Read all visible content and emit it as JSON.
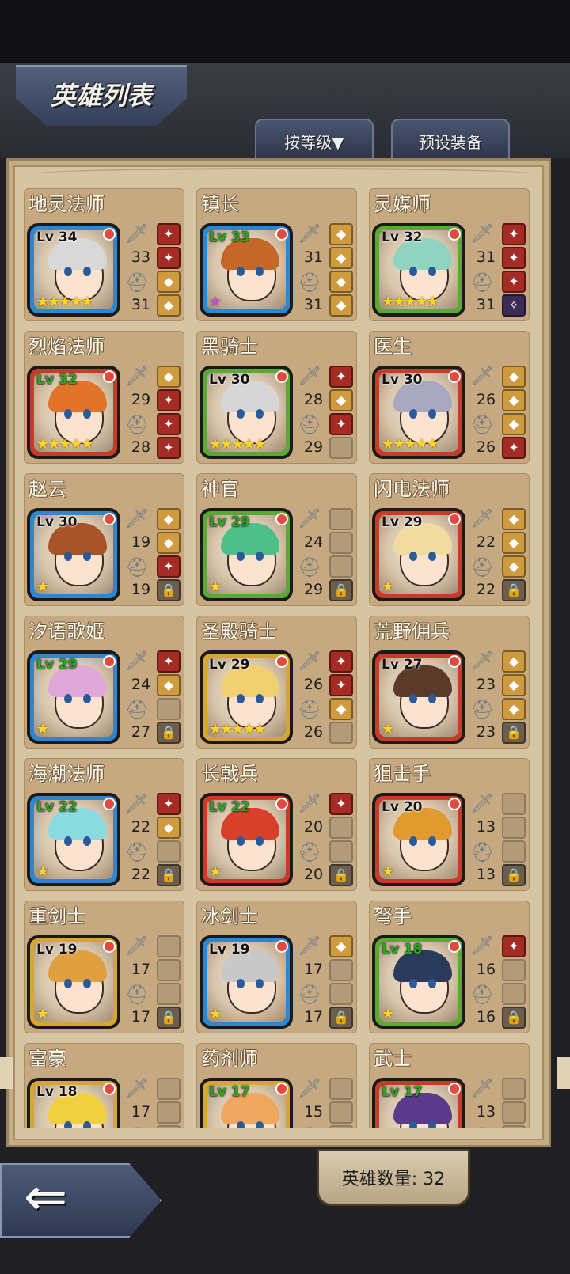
{
  "header": {
    "title": "英雄列表"
  },
  "toolbar": {
    "sort_label": "按等级▼",
    "preset_label": "预设装备"
  },
  "footer": {
    "hero_count": "英雄数量: 32",
    "back_arrow": "⇐"
  },
  "heroes": [
    {
      "name": "地灵法师",
      "lv": "Lv 34",
      "atk": "33",
      "def": "31",
      "frame": "frame-blue",
      "hair": "#d8d8d8",
      "stars": "★★★★★",
      "slots": [
        "filled-red",
        "filled-red",
        "filled-gold",
        "filled-gold"
      ],
      "lvgreen": false
    },
    {
      "name": "镇长",
      "lv": "Lv 33",
      "atk": "31",
      "def": "31",
      "frame": "frame-blue",
      "hair": "#c4682a",
      "stars": "★",
      "purple": true,
      "slots": [
        "filled-gold",
        "filled-gold",
        "filled-gold",
        "filled-gold"
      ],
      "lvgreen": true
    },
    {
      "name": "灵媒师",
      "lv": "Lv 32",
      "atk": "31",
      "def": "31",
      "frame": "frame-green",
      "hair": "#8fd3c0",
      "stars": "★★★★★",
      "slots": [
        "filled-red",
        "filled-red",
        "filled-red",
        "filled-purple"
      ],
      "lvgreen": false
    },
    {
      "name": "烈焰法师",
      "lv": "Lv 32",
      "atk": "29",
      "def": "28",
      "frame": "frame-red",
      "hair": "#e2742a",
      "stars": "★★★★★",
      "slots": [
        "filled-gold",
        "filled-red",
        "filled-red",
        "filled-red"
      ],
      "lvgreen": true
    },
    {
      "name": "黑骑士",
      "lv": "Lv 30",
      "atk": "28",
      "def": "29",
      "frame": "frame-green",
      "hair": "#d6d6d6",
      "stars": "★★★★★",
      "slots": [
        "filled-red",
        "filled-gold",
        "filled-red",
        "empty"
      ],
      "lvgreen": false
    },
    {
      "name": "医生",
      "lv": "Lv 30",
      "atk": "26",
      "def": "26",
      "frame": "frame-red",
      "hair": "#a8a8c0",
      "stars": "★★★★★",
      "slots": [
        "filled-gold",
        "filled-gold",
        "filled-gold",
        "filled-red"
      ],
      "lvgreen": false
    },
    {
      "name": "赵云",
      "lv": "Lv 30",
      "atk": "19",
      "def": "19",
      "frame": "frame-blue",
      "hair": "#a8542a",
      "stars": "★",
      "slots": [
        "filled-gold",
        "filled-gold",
        "filled-red",
        "lock"
      ],
      "lvgreen": false
    },
    {
      "name": "神官",
      "lv": "Lv 29",
      "atk": "24",
      "def": "29",
      "frame": "frame-green",
      "hair": "#4fbf8a",
      "stars": "★",
      "slots": [
        "empty",
        "empty",
        "empty",
        "lock"
      ],
      "lvgreen": true
    },
    {
      "name": "闪电法师",
      "lv": "Lv 29",
      "atk": "22",
      "def": "22",
      "frame": "frame-red",
      "hair": "#f0dba0",
      "stars": "★",
      "slots": [
        "filled-gold",
        "filled-gold",
        "filled-gold",
        "lock"
      ],
      "lvgreen": false
    },
    {
      "name": "汐语歌姬",
      "lv": "Lv 29",
      "atk": "24",
      "def": "27",
      "frame": "frame-blue",
      "hair": "#e0a8d8",
      "stars": "★",
      "slots": [
        "filled-red",
        "filled-gold",
        "empty",
        "lock"
      ],
      "lvgreen": true
    },
    {
      "name": "圣殿骑士",
      "lv": "Lv 29",
      "atk": "26",
      "def": "26",
      "frame": "frame-gold",
      "hair": "#f0d070",
      "stars": "★★★★★",
      "slots": [
        "filled-red",
        "filled-red",
        "filled-gold",
        "empty"
      ],
      "lvgreen": false
    },
    {
      "name": "荒野佣兵",
      "lv": "Lv 27",
      "atk": "23",
      "def": "23",
      "frame": "frame-red",
      "hair": "#5a3a2a",
      "stars": "★",
      "slots": [
        "filled-gold",
        "filled-gold",
        "filled-gold",
        "lock"
      ],
      "lvgreen": false
    },
    {
      "name": "海潮法师",
      "lv": "Lv 22",
      "atk": "22",
      "def": "22",
      "frame": "frame-blue",
      "hair": "#8adbe0",
      "stars": "★",
      "slots": [
        "filled-red",
        "filled-gold",
        "empty",
        "lock"
      ],
      "lvgreen": true
    },
    {
      "name": "长戟兵",
      "lv": "Lv 22",
      "atk": "20",
      "def": "20",
      "frame": "frame-red",
      "hair": "#d8402a",
      "stars": "★",
      "slots": [
        "filled-red",
        "empty",
        "empty",
        "lock"
      ],
      "lvgreen": true
    },
    {
      "name": "狙击手",
      "lv": "Lv 20",
      "atk": "13",
      "def": "13",
      "frame": "frame-red",
      "hair": "#e09a30",
      "stars": "★",
      "slots": [
        "empty",
        "empty",
        "empty",
        "lock"
      ],
      "lvgreen": false
    },
    {
      "name": "重剑士",
      "lv": "Lv 19",
      "atk": "17",
      "def": "17",
      "frame": "frame-gold",
      "hair": "#e0a040",
      "stars": "★",
      "slots": [
        "empty",
        "empty",
        "empty",
        "lock"
      ],
      "lvgreen": false
    },
    {
      "name": "冰剑士",
      "lv": "Lv 19",
      "atk": "17",
      "def": "17",
      "frame": "frame-blue",
      "hair": "#c8c8c8",
      "stars": "★",
      "slots": [
        "filled-gold",
        "empty",
        "empty",
        "lock"
      ],
      "lvgreen": false
    },
    {
      "name": "弩手",
      "lv": "Lv 18",
      "atk": "16",
      "def": "16",
      "frame": "frame-green",
      "hair": "#2a3a5a",
      "stars": "★",
      "slots": [
        "filled-red",
        "empty",
        "empty",
        "lock"
      ],
      "lvgreen": true
    },
    {
      "name": "富豪",
      "lv": "Lv 18",
      "atk": "17",
      "def": "",
      "frame": "frame-gold",
      "hair": "#f0d040",
      "stars": "",
      "slots": [
        "empty",
        "empty",
        "empty",
        "empty"
      ],
      "lvgreen": false
    },
    {
      "name": "药剂师",
      "lv": "Lv 17",
      "atk": "15",
      "def": "",
      "frame": "frame-gold",
      "hair": "#f0a860",
      "stars": "",
      "slots": [
        "empty",
        "empty",
        "empty",
        "empty"
      ],
      "lvgreen": true
    },
    {
      "name": "武士",
      "lv": "Lv 17",
      "atk": "13",
      "def": "",
      "frame": "frame-red",
      "hair": "#5a3a8a",
      "stars": "",
      "slots": [
        "empty",
        "empty",
        "empty",
        "empty"
      ],
      "lvgreen": true
    }
  ]
}
